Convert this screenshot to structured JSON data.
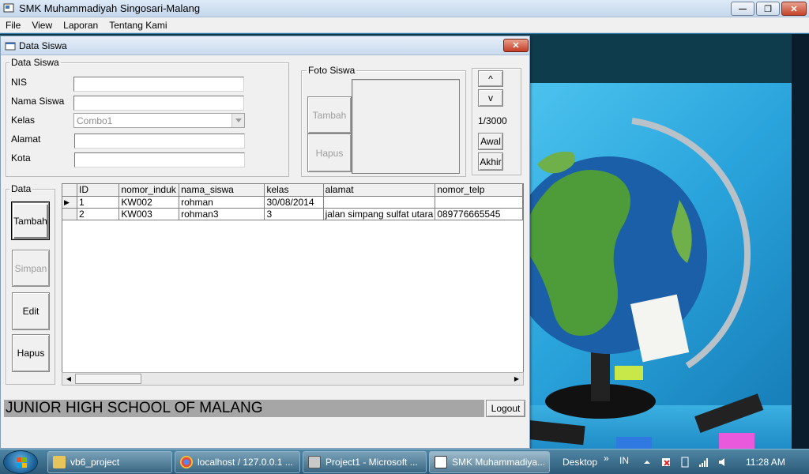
{
  "app": {
    "title": "SMK Muhammadiyah Singosari-Malang",
    "menu": [
      "File",
      "View",
      "Laporan",
      "Tentang Kami"
    ]
  },
  "window_controls": {
    "minimize": "—",
    "maximize": "❐",
    "close": "✕"
  },
  "child": {
    "title": "Data Siswa",
    "close": "✕",
    "form": {
      "frame_label": "Data Siswa",
      "fields": {
        "nis": {
          "label": "NIS",
          "value": ""
        },
        "nama": {
          "label": "Nama Siswa",
          "value": ""
        },
        "kelas": {
          "label": "Kelas",
          "value": "Combo1"
        },
        "alamat": {
          "label": "Alamat",
          "value": ""
        },
        "kota": {
          "label": "Kota",
          "value": ""
        }
      }
    },
    "photo": {
      "frame_label": "Foto Siswa",
      "tambah": "Tambah",
      "hapus": "Hapus"
    },
    "nav": {
      "up": "^",
      "down": "v",
      "position": "1/3000",
      "awal": "Awal",
      "akhir": "Akhir"
    },
    "data_frame": {
      "label": "Data",
      "tambah": "Tambah",
      "simpan": "Simpan",
      "edit": "Edit",
      "hapus": "Hapus"
    },
    "grid": {
      "columns": [
        "ID",
        "nomor_induk",
        "nama_siswa",
        "kelas",
        "alamat",
        "nomor_telp"
      ],
      "rows": [
        [
          "1",
          "KW002",
          "rohman",
          "30/08/2014",
          "",
          ""
        ],
        [
          "2",
          "KW003",
          "rohman3",
          "3",
          "jalan simpang sulfat utara",
          "089776665545"
        ]
      ],
      "current_row_marker": "▶"
    },
    "status": "JUNIOR HIGH SCHOOL OF MALANG",
    "logout": "Logout"
  },
  "taskbar": {
    "items": [
      "vb6_project",
      "localhost / 127.0.0.1 ...",
      "Project1 - Microsoft ...",
      "SMK Muhammadiya..."
    ],
    "desktop": "Desktop",
    "chevron": "»",
    "lang": "IN",
    "time": "11:28 AM"
  },
  "colors": {
    "status_bar": "#a6a6a6",
    "titlebar": "#c9dbee",
    "close_button": "#c43c26"
  }
}
